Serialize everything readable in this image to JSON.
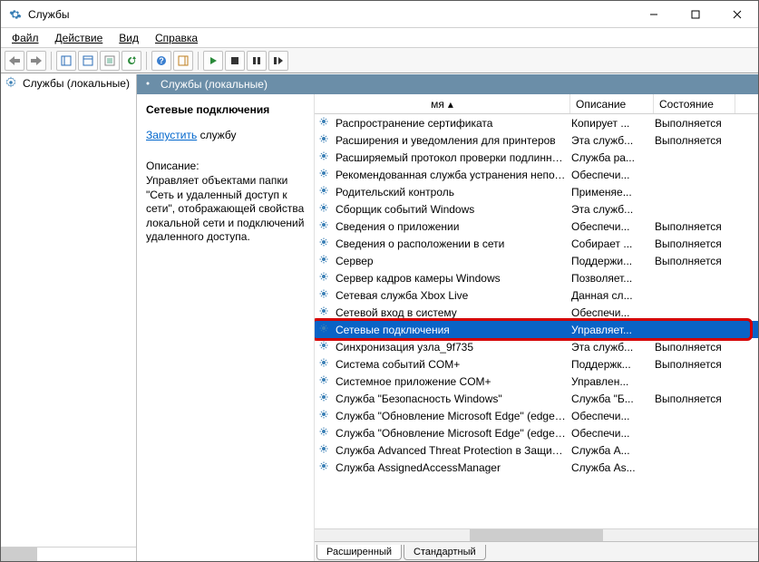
{
  "window": {
    "title": "Службы"
  },
  "menu": {
    "file": "Файл",
    "action": "Действие",
    "view": "Вид",
    "help": "Справка"
  },
  "tree": {
    "root": "Службы (локальные)"
  },
  "pane_header": "Службы (локальные)",
  "details": {
    "title": "Сетевые подключения",
    "action_link": "Запустить",
    "action_rest": " службу",
    "desc_label": "Описание:",
    "desc": "Управляет объектами папки \"Сеть и удаленный доступ к сети\", отображающей свойства локальной сети и подключений удаленного доступа."
  },
  "columns": {
    "name_suffix": "мя",
    "desc": "Описание",
    "state": "Состояние"
  },
  "rows": [
    {
      "name": "Распространение сертификата",
      "desc": "Копирует ...",
      "state": "Выполняется"
    },
    {
      "name": "Расширения и уведомления для принтеров",
      "desc": "Эта служб...",
      "state": "Выполняется"
    },
    {
      "name": "Расширяемый протокол проверки подлиннос...",
      "desc": "Служба ра...",
      "state": ""
    },
    {
      "name": "Рекомендованная служба устранения непола...",
      "desc": "Обеспечи...",
      "state": ""
    },
    {
      "name": "Родительский контроль",
      "desc": "Применяе...",
      "state": ""
    },
    {
      "name": "Сборщик событий Windows",
      "desc": "Эта служб...",
      "state": ""
    },
    {
      "name": "Сведения о приложении",
      "desc": "Обеспечи...",
      "state": "Выполняется"
    },
    {
      "name": "Сведения о расположении в сети",
      "desc": "Собирает ...",
      "state": "Выполняется"
    },
    {
      "name": "Сервер",
      "desc": "Поддержи...",
      "state": "Выполняется"
    },
    {
      "name": "Сервер кадров камеры Windows",
      "desc": "Позволяет...",
      "state": ""
    },
    {
      "name": "Сетевая служба Xbox Live",
      "desc": "Данная сл...",
      "state": ""
    },
    {
      "name": "Сетевой вход в систему",
      "desc": "Обеспечи...",
      "state": ""
    },
    {
      "name": "Сетевые подключения",
      "desc": "Управляет...",
      "state": "",
      "selected": true
    },
    {
      "name": "Синхронизация узла_9f735",
      "desc": "Эта служб...",
      "state": "Выполняется"
    },
    {
      "name": "Система событий COM+",
      "desc": "Поддержк...",
      "state": "Выполняется"
    },
    {
      "name": "Системное приложение COM+",
      "desc": "Управлен...",
      "state": ""
    },
    {
      "name": "Служба \"Безопасность Windows\"",
      "desc": "Служба \"Б...",
      "state": "Выполняется"
    },
    {
      "name": "Служба \"Обновление Microsoft Edge\" (edgeup...",
      "desc": "Обеспечи...",
      "state": ""
    },
    {
      "name": "Служба \"Обновление Microsoft Edge\" (edgeup...",
      "desc": "Обеспечи...",
      "state": ""
    },
    {
      "name": "Служба Advanced Threat Protection в Защитн...",
      "desc": "Служба A...",
      "state": ""
    },
    {
      "name": "Служба AssignedAccessManager",
      "desc": "Служба As...",
      "state": ""
    }
  ],
  "tabs": {
    "extended": "Расширенный",
    "standard": "Стандартный"
  }
}
